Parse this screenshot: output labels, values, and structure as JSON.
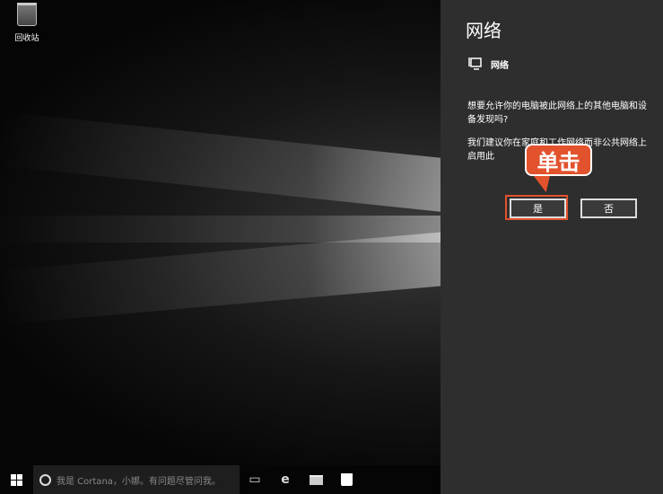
{
  "desktop": {
    "recycle_bin_label": "回收站"
  },
  "panel": {
    "title": "网络",
    "network_name": "网络",
    "question": "想要允许你的电脑被此网络上的其他电脑和设备发现吗?",
    "recommendation": "我们建议你在家庭和工作网络而非公共网络上启用此",
    "yes_label": "是",
    "no_label": "否"
  },
  "annotation": {
    "callout_text": "单击",
    "color": "#e2522c"
  },
  "taskbar": {
    "search_placeholder": "我是 Cortana，小娜。有问题尽管问我。"
  }
}
